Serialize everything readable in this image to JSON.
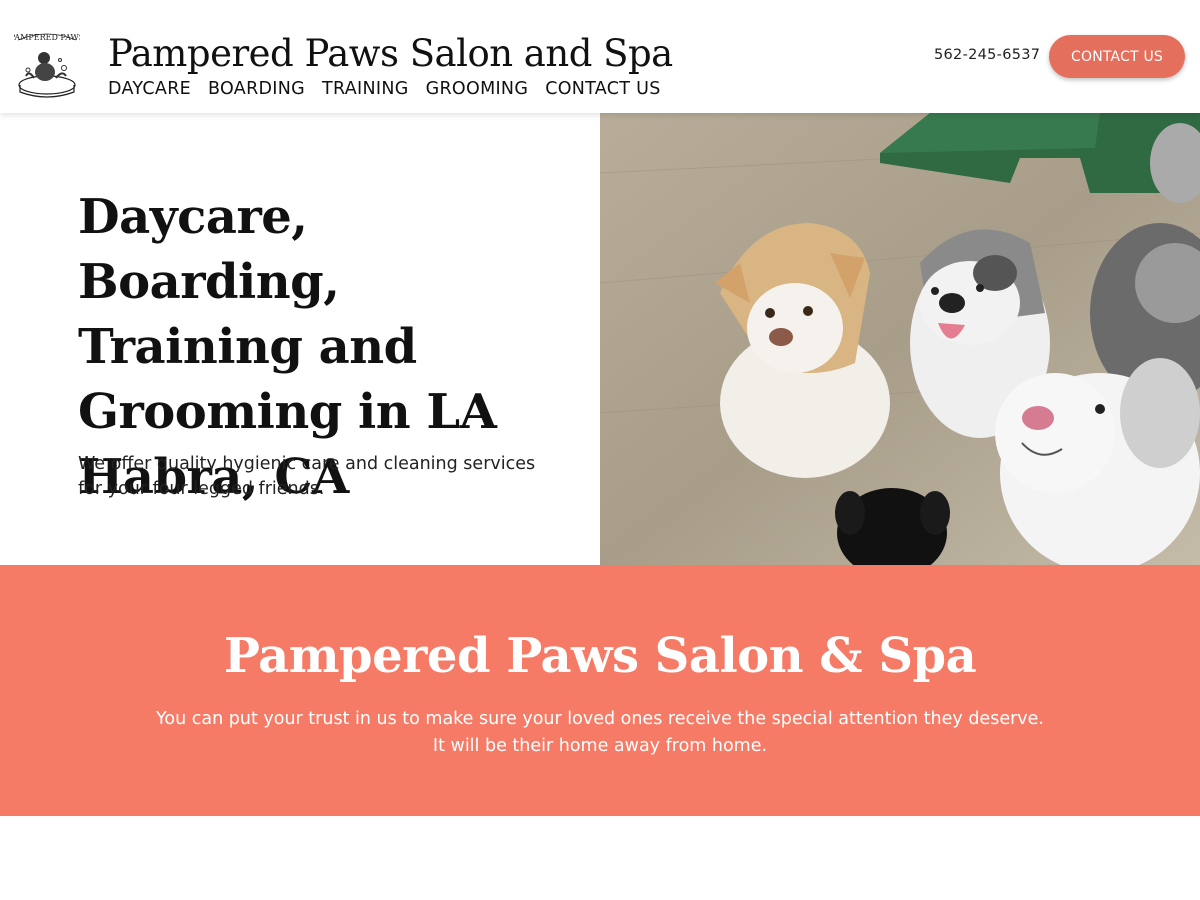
{
  "header": {
    "logo_text": "PAMPERED PAWS",
    "site_title": "Pampered Paws Salon and Spa",
    "nav": [
      "DAYCARE",
      "BOARDING",
      "TRAINING",
      "GROOMING",
      "CONTACT US"
    ],
    "phone": "562-245-6537",
    "contact_button": "CONTACT US"
  },
  "hero": {
    "heading": "Daycare, Boarding, Training and Grooming in LA Habra, CA",
    "subtext": "We offer quality hygienic care and cleaning services for your four legged friends.",
    "photo_icon": "dogs-photo"
  },
  "band": {
    "title": "Pampered Paws Salon & Spa",
    "line1": "You can put your trust in us to make sure your loved ones receive the special attention they deserve.",
    "line2": "It will be their home away from home."
  },
  "colors": {
    "accent_button": "#e36f5c",
    "band_background": "#f67b67",
    "text_dark": "#111111"
  }
}
